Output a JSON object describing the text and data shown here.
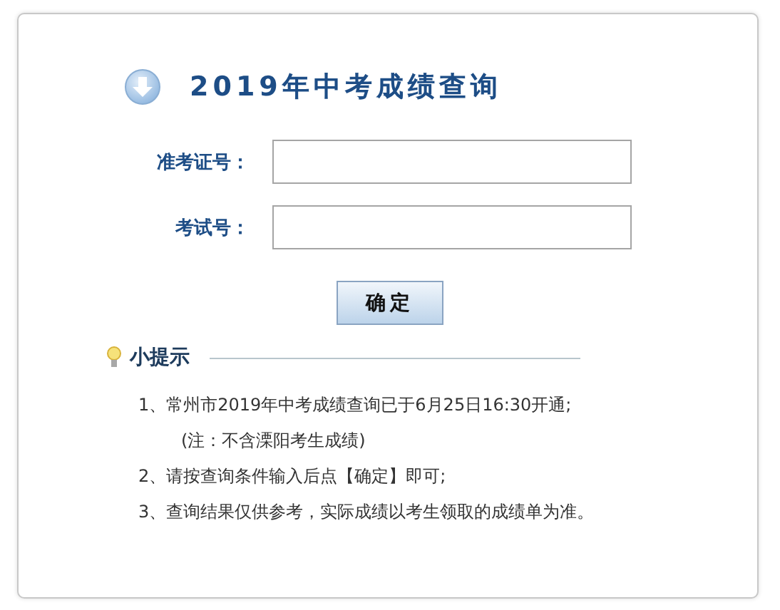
{
  "title": "2019年中考成绩查询",
  "fields": [
    {
      "label": "准考证号："
    },
    {
      "label": "考试号："
    }
  ],
  "button": "确定",
  "tips": {
    "heading": "小提示",
    "items": [
      {
        "kind": "item",
        "text": "1、常州市2019年中考成绩查询已于6月25日16:30开通;"
      },
      {
        "kind": "note",
        "text": "(注：不含溧阳考生成绩)"
      },
      {
        "kind": "item",
        "text": "2、请按查询条件输入后点【确定】即可;"
      },
      {
        "kind": "item",
        "text": "3、查询结果仅供参考，实际成绩以考生领取的成绩单为准。"
      }
    ]
  }
}
